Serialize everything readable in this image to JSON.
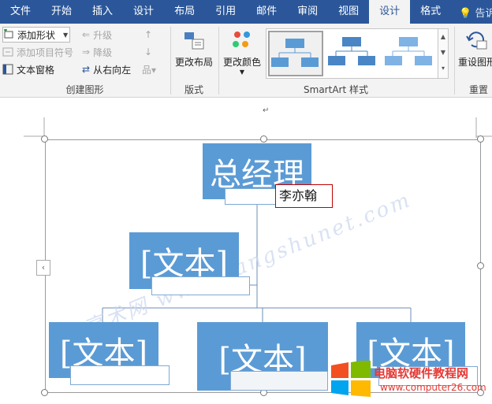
{
  "menu": {
    "tabs": [
      "文件",
      "开始",
      "插入",
      "设计",
      "布局",
      "引用",
      "邮件",
      "审阅",
      "视图",
      "设计",
      "格式"
    ],
    "active_index": 9,
    "tell_me": "告诉"
  },
  "ribbon": {
    "create_graphic": {
      "add_shape": "添加形状",
      "add_bullet": "添加项目符号",
      "text_pane": "文本窗格",
      "promote": "升级",
      "demote": "降级",
      "right_to_left": "从右向左",
      "label": "创建图形"
    },
    "layouts": {
      "change_layout": "更改布局",
      "label": "版式"
    },
    "smartart_styles": {
      "change_colors": "更改颜色",
      "label": "SmartArt 样式"
    },
    "reset": {
      "reset_graphic": "重设图形",
      "label": "重置"
    }
  },
  "document": {
    "paragraph_mark": "↵",
    "top_node": {
      "text": "总经理",
      "subtext": "李亦翰"
    },
    "level2_node": {
      "text": "[文本]"
    },
    "level3_nodes": [
      {
        "text": "[文本]"
      },
      {
        "text": "[文本]"
      },
      {
        "text": "[文本]"
      }
    ]
  },
  "watermarks": {
    "diag": "亮术网 www.liangshunet.com",
    "site_name": "电脑软硬件教程网",
    "site_url": "www.computer26.com"
  },
  "colors": {
    "title_bar": "#2b579a",
    "node_fill": "#5b9bd5",
    "edit_border": "#c00000"
  }
}
